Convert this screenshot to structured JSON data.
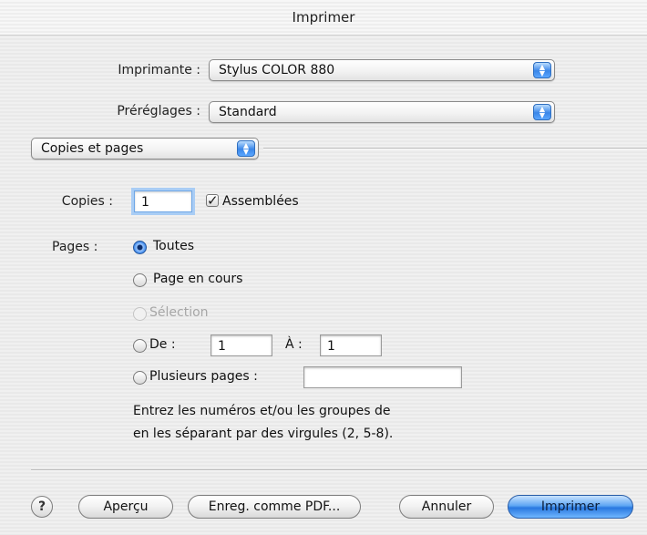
{
  "window": {
    "title": "Imprimer"
  },
  "printer": {
    "label": "Imprimante :",
    "value": "Stylus COLOR 880"
  },
  "presets": {
    "label": "Préréglages :",
    "value": "Standard"
  },
  "section": {
    "value": "Copies et pages"
  },
  "copies": {
    "label": "Copies :",
    "value": "1",
    "collate_label": "Assemblées",
    "collate_checked": true
  },
  "pages": {
    "label": "Pages :",
    "all": "Toutes",
    "current": "Page en cours",
    "selection": "Sélection",
    "from_label": "De :",
    "from_value": "1",
    "to_label": "À :",
    "to_value": "1",
    "multiple_label": "Plusieurs pages :",
    "multiple_value": "",
    "hint_line1": "Entrez les numéros et/ou les groupes de",
    "hint_line2": "en les séparant par des virgules (2, 5-8).",
    "selected": "all"
  },
  "buttons": {
    "help": "?",
    "preview": "Aperçu",
    "save_pdf": "Enreg. comme PDF...",
    "cancel": "Annuler",
    "print": "Imprimer"
  },
  "colors": {
    "accent": "#2f7fe8",
    "default_button": "#4f9bf0"
  }
}
